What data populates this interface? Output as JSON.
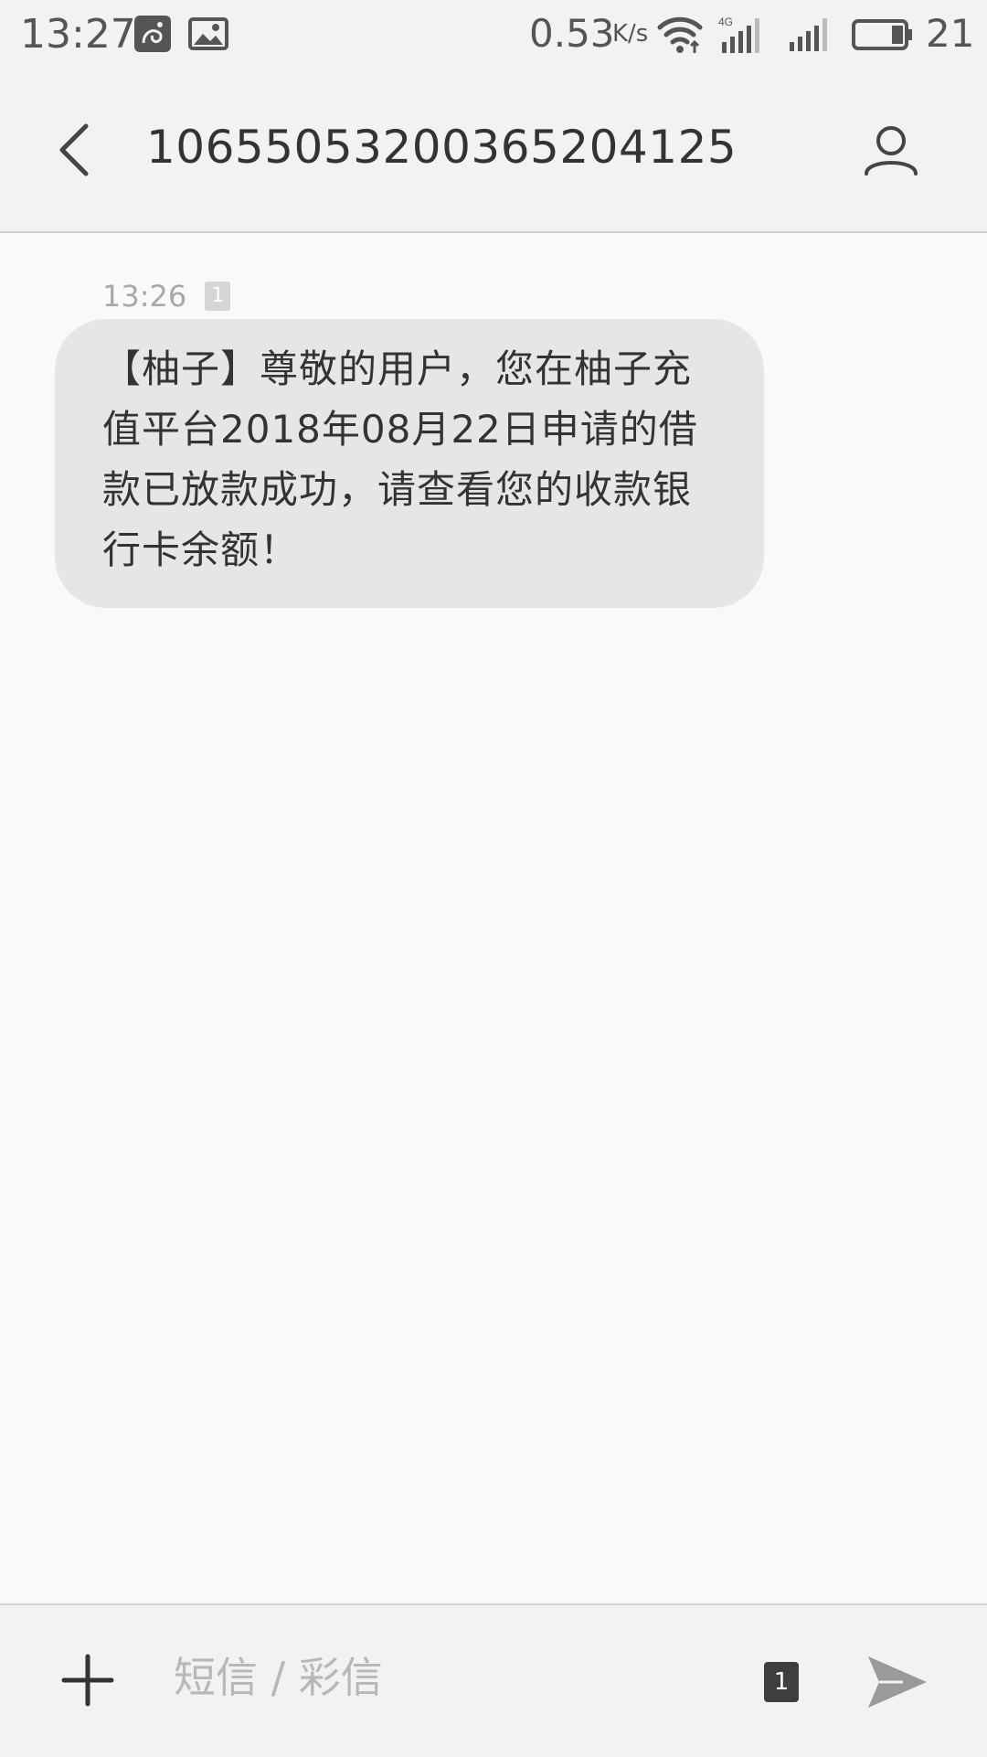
{
  "status_bar": {
    "time": "13:27",
    "net_speed": "0.53",
    "net_speed_unit": "K/s",
    "network_type": "4G",
    "battery_level": "21",
    "icons": [
      "uc-browser-icon",
      "gallery-icon",
      "wifi-icon",
      "signal-4g-icon",
      "signal-icon",
      "battery-icon"
    ]
  },
  "header": {
    "title": "1065505320036520​4125"
  },
  "conversation": {
    "messages": [
      {
        "time": "13:26",
        "sim": "1",
        "text": "【柚子】尊敬的用户，您在柚子充值平台2018年08月22日申请的借款已放款成功，请查看您的收款银行卡余额！"
      }
    ]
  },
  "composer": {
    "placeholder": "短信 / 彩信",
    "value": "",
    "sim": "1"
  },
  "colors": {
    "background": "#f9f9f9",
    "bar": "#f2f2f2",
    "bubble": "#e6e6e6",
    "text": "#333333",
    "muted": "#a8a8a8"
  }
}
